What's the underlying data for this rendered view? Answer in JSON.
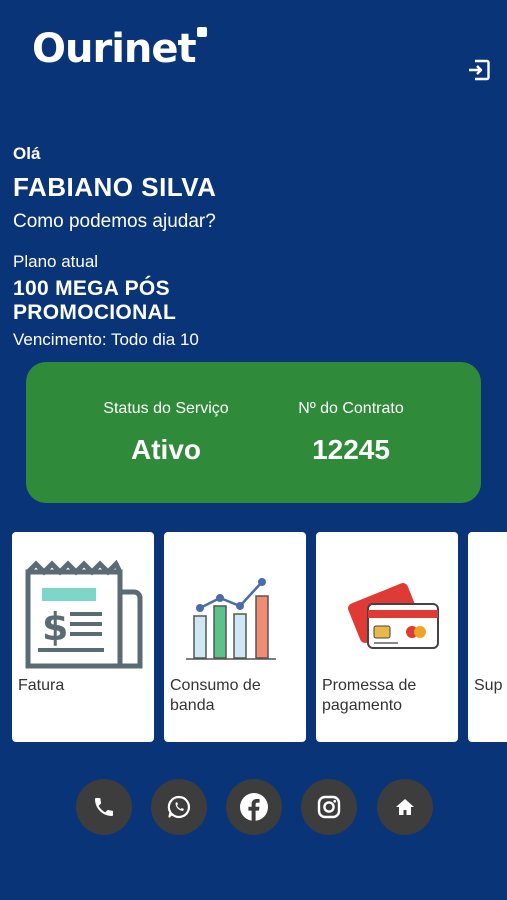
{
  "header": {
    "brand": "Ourinet",
    "logout_icon": "logout-icon"
  },
  "user": {
    "greeting": "Olá",
    "name": "FABIANO SILVA",
    "help_text": "Como podemos ajudar?"
  },
  "plan": {
    "label": "Plano atual",
    "name": "100 MEGA PÓS PROMOCIONAL",
    "due": "Vencimento: Todo dia 10"
  },
  "status_card": {
    "color": "#2f8a3a",
    "service_status_label": "Status do Serviço",
    "service_status_value": "Ativo",
    "contract_label": "Nº do Contrato",
    "contract_value": "12245"
  },
  "shortcuts": [
    {
      "label": "Fatura",
      "icon": "invoice-icon"
    },
    {
      "label": "Consumo de banda",
      "icon": "bandwidth-chart-icon"
    },
    {
      "label": "Promessa de pagamento",
      "icon": "credit-card-icon"
    },
    {
      "label": "Sup",
      "icon": "support-icon"
    }
  ],
  "socials": [
    {
      "icon": "phone-icon"
    },
    {
      "icon": "whatsapp-icon"
    },
    {
      "icon": "facebook-icon"
    },
    {
      "icon": "instagram-icon"
    },
    {
      "icon": "home-icon"
    }
  ],
  "colors": {
    "background": "#0a3478",
    "social_button": "#3d3d3d"
  }
}
